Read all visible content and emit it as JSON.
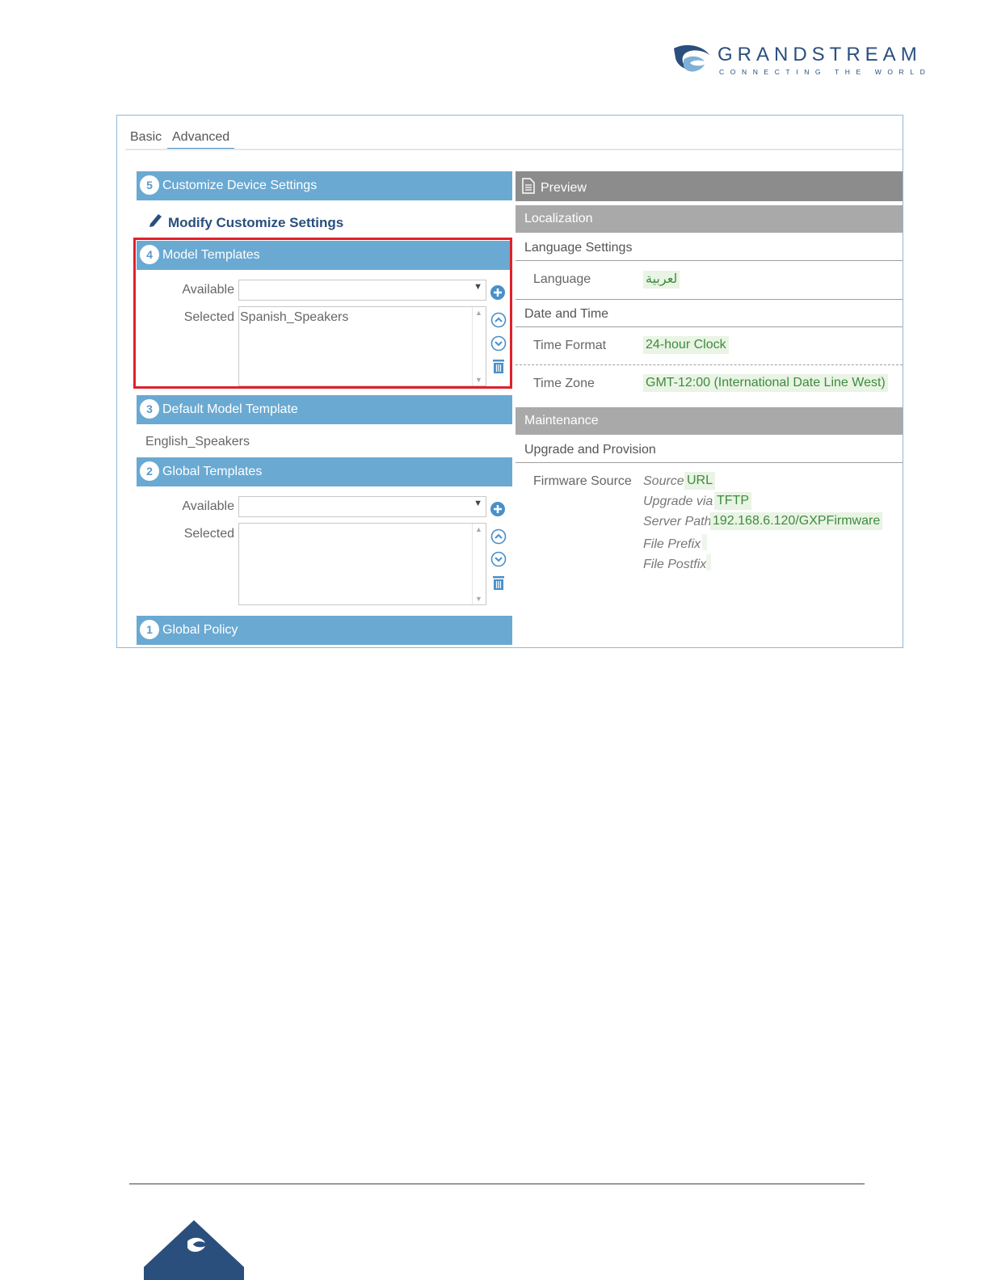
{
  "brand": {
    "name": "GRANDSTREAM",
    "tagline": "CONNECTING THE WORLD",
    "color": "#2a4f7d"
  },
  "tabs": [
    "Basic",
    "Advanced"
  ],
  "active_tab": "Advanced",
  "left_panel": {
    "customize": {
      "number": "5",
      "title": "Customize Device Settings",
      "modify_link": "Modify Customize Settings"
    },
    "model_templates": {
      "number": "4",
      "title": "Model Templates",
      "available_label": "Available",
      "available_value": "",
      "selected_label": "Selected",
      "selected_items": [
        "Spanish_Speakers"
      ]
    },
    "default_model_template": {
      "number": "3",
      "title": "Default Model Template",
      "value": "English_Speakers"
    },
    "global_templates": {
      "number": "2",
      "title": "Global Templates",
      "available_label": "Available",
      "available_value": "",
      "selected_label": "Selected",
      "selected_items": []
    },
    "global_policy": {
      "number": "1",
      "title": "Global Policy"
    }
  },
  "preview": {
    "title": "Preview",
    "localization": {
      "title": "Localization",
      "language_settings": "Language Settings",
      "language_label": "Language",
      "language_value": "لعربية",
      "date_time": "Date and Time",
      "time_format_label": "Time Format",
      "time_format_value": "24-hour Clock",
      "time_zone_label": "Time Zone",
      "time_zone_value": "GMT-12:00 (International Date Line West)"
    },
    "maintenance": {
      "title": "Maintenance",
      "upgrade_provision": "Upgrade and Provision",
      "firmware_source_label": "Firmware Source",
      "source_label": "Source",
      "source_value": "URL",
      "upgrade_via_label": "Upgrade via",
      "upgrade_via_value": "TFTP",
      "server_path_label": "Server Path",
      "server_path_value": "192.168.6.120/GXPFirmware",
      "file_prefix_label": "File Prefix",
      "file_postfix_label": "File Postfix"
    }
  },
  "colors": {
    "section_bar": "#6aa9d2",
    "preview_bar": "#8c8c8c",
    "highlight_border": "#e0202a",
    "value_text": "#3f8a3f"
  }
}
